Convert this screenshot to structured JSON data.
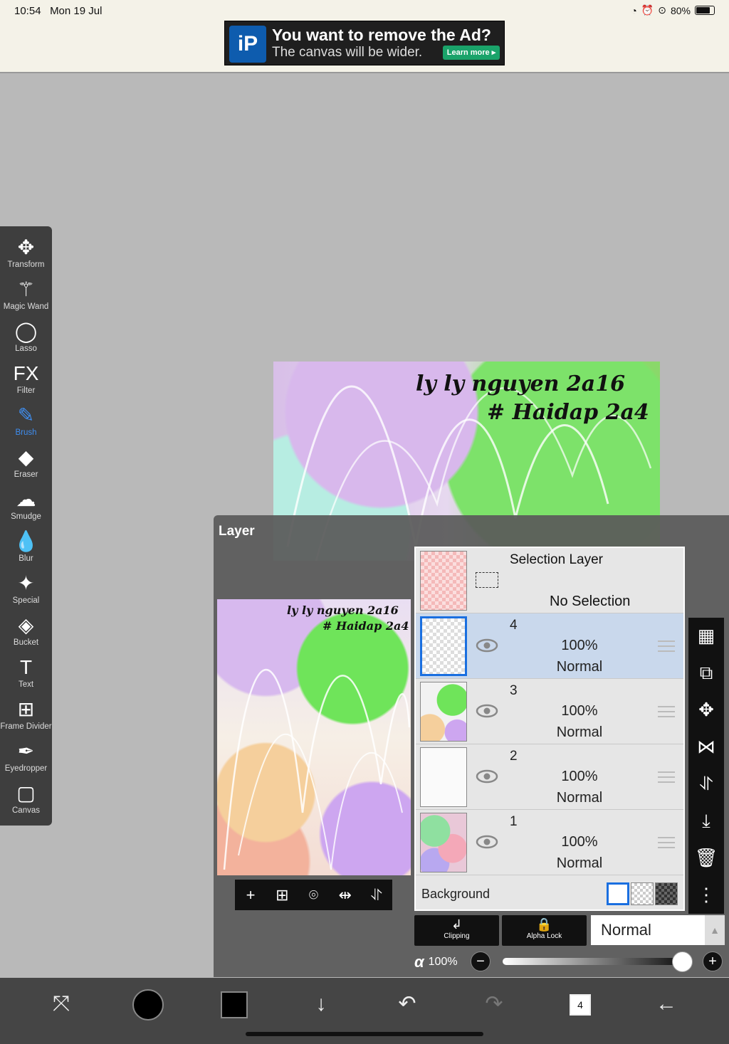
{
  "status": {
    "time": "10:54",
    "date": "Mon 19 Jul",
    "battery": "80%"
  },
  "ad": {
    "title": "You want to remove the Ad?",
    "subtitle": "The canvas will be wider.",
    "button": "Learn more ▸",
    "logo": "iP"
  },
  "artwork": {
    "line1": "ly ly nguyen 2a16",
    "line2": "# Haidap 2a4"
  },
  "toolbar": {
    "items": [
      {
        "label": "Transform",
        "icon": "move-icon",
        "glyph": "✥"
      },
      {
        "label": "Magic Wand",
        "icon": "magic-wand-icon",
        "glyph": "⚚"
      },
      {
        "label": "Lasso",
        "icon": "lasso-icon",
        "glyph": "◯"
      },
      {
        "label": "Filter",
        "icon": "fx-icon",
        "glyph": "FX"
      },
      {
        "label": "Brush",
        "icon": "brush-icon",
        "glyph": "✎"
      },
      {
        "label": "Eraser",
        "icon": "eraser-icon",
        "glyph": "◆"
      },
      {
        "label": "Smudge",
        "icon": "smudge-icon",
        "glyph": "☁"
      },
      {
        "label": "Blur",
        "icon": "blur-drop-icon",
        "glyph": "💧"
      },
      {
        "label": "Special",
        "icon": "special-icon",
        "glyph": "✦"
      },
      {
        "label": "Bucket",
        "icon": "bucket-icon",
        "glyph": "◈"
      },
      {
        "label": "Text",
        "icon": "text-icon",
        "glyph": "T"
      },
      {
        "label": "Frame Divider",
        "icon": "frame-divider-icon",
        "glyph": "⊞"
      },
      {
        "label": "Eyedropper",
        "icon": "eyedropper-icon",
        "glyph": "✒"
      },
      {
        "label": "Canvas",
        "icon": "canvas-icon",
        "glyph": "▢"
      }
    ],
    "active": "Brush"
  },
  "layer_panel": {
    "title": "Layer",
    "preview_text": {
      "line1": "ly ly nguyen 2a16",
      "line2": "# Haidap 2a4"
    },
    "selection_layer": {
      "name": "Selection Layer",
      "state": "No Selection"
    },
    "layers": [
      {
        "number": "4",
        "opacity": "100%",
        "mode": "Normal",
        "selected": true
      },
      {
        "number": "3",
        "opacity": "100%",
        "mode": "Normal",
        "selected": false
      },
      {
        "number": "2",
        "opacity": "100%",
        "mode": "Normal",
        "selected": false
      },
      {
        "number": "1",
        "opacity": "100%",
        "mode": "Normal",
        "selected": false
      }
    ],
    "background_label": "Background",
    "clipping_label": "Clipping",
    "alpha_lock_label": "Alpha Lock",
    "blend_mode": "Normal",
    "alpha_symbol": "α",
    "alpha_value": "100%",
    "opacity_fraction": 1.0
  },
  "bottom_bar": {
    "layer_count": "4"
  },
  "colors": {
    "accent": "#3e8ef0",
    "selected_row": "#c9d8ec",
    "primary": "#000000"
  }
}
